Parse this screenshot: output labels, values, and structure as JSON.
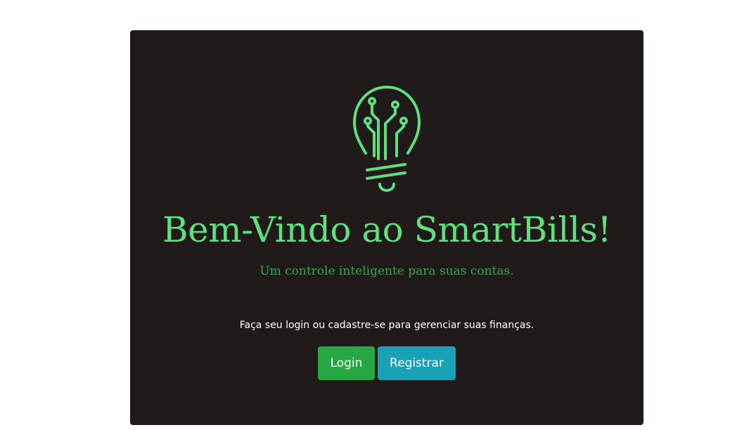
{
  "welcome": {
    "logo_icon": "lightbulb-circuit-icon",
    "title": "Bem-Vindo ao SmartBills!",
    "subtitle": "Um controle inteligente para suas contas.",
    "prompt": "Faça seu login ou cadastre-se para gerenciar suas finanças.",
    "login_label": "Login",
    "register_label": "Registrar"
  },
  "colors": {
    "page_background": "#ffffff",
    "card_background": "#201a1b",
    "title_green": "#5ee07f",
    "subtitle_green": "#3aa356",
    "login_button": "#28a745",
    "register_button": "#17a2b8"
  }
}
